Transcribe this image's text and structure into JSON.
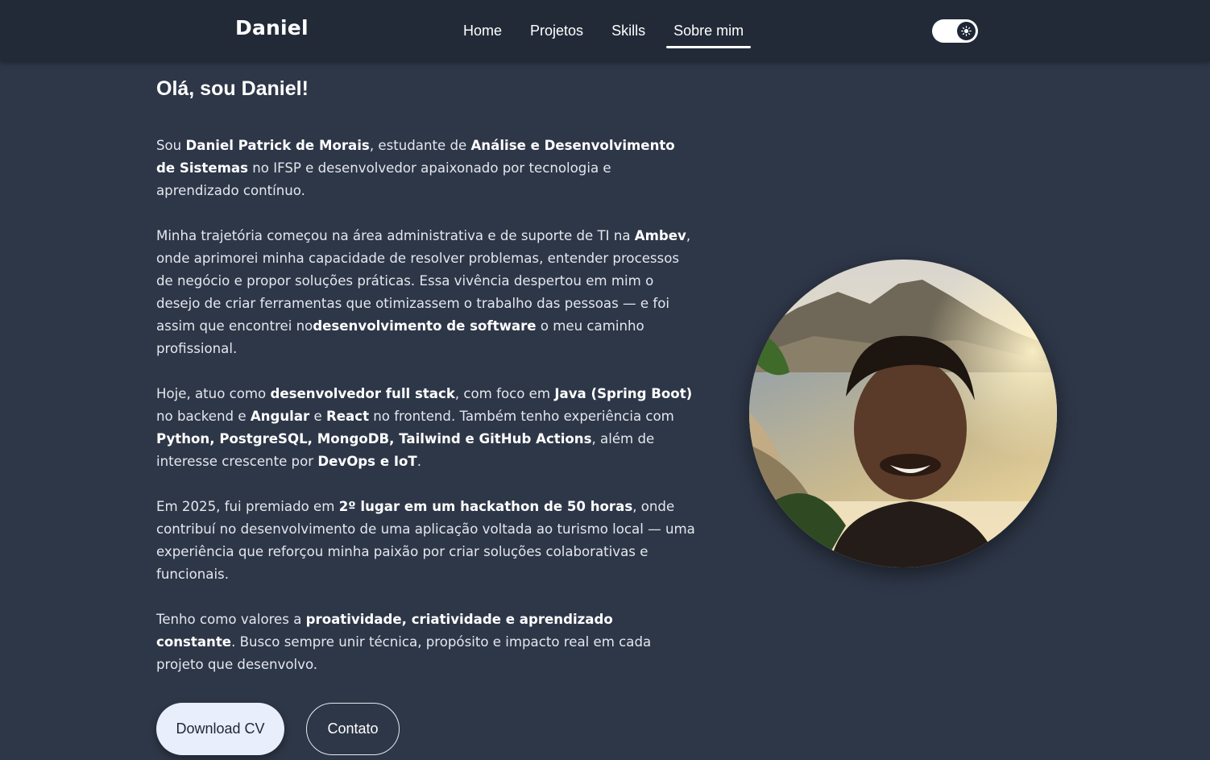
{
  "brand": "Daniel",
  "nav": [
    {
      "label": "Home",
      "active": false
    },
    {
      "label": "Projetos",
      "active": false
    },
    {
      "label": "Skills",
      "active": false
    },
    {
      "label": "Sobre mim",
      "active": true
    }
  ],
  "theme_toggle": {
    "icon": "sun-icon",
    "state": "dark"
  },
  "about": {
    "heading": "Olá, sou Daniel!",
    "paragraphs": [
      [
        {
          "t": "Sou "
        },
        {
          "t": "Daniel Patrick de Morais",
          "b": true
        },
        {
          "t": ", estudante de "
        },
        {
          "t": "Análise e Desenvolvimento de Sistemas",
          "b": true
        },
        {
          "t": " no IFSP e desenvolvedor apaixonado por tecnologia e aprendizado contínuo."
        }
      ],
      [
        {
          "t": "Minha trajetória começou na área administrativa e de suporte de TI na "
        },
        {
          "t": "Ambev",
          "b": true
        },
        {
          "t": ", onde aprimorei minha capacidade de resolver problemas, entender processos de negócio e propor soluções práticas. Essa vivência despertou em mim o desejo de criar ferramentas que otimizassem o trabalho das pessoas — e foi assim que encontrei no"
        },
        {
          "t": "desenvolvimento de software",
          "b": true
        },
        {
          "t": " o meu caminho profissional."
        }
      ],
      [
        {
          "t": "Hoje, atuo como "
        },
        {
          "t": "desenvolvedor full stack",
          "b": true
        },
        {
          "t": ", com foco em "
        },
        {
          "t": "Java (Spring Boot)",
          "b": true
        },
        {
          "t": " no backend e "
        },
        {
          "t": "Angular",
          "b": true
        },
        {
          "t": " e "
        },
        {
          "t": "React",
          "b": true
        },
        {
          "t": " no frontend. Também tenho experiência com "
        },
        {
          "t": "Python, PostgreSQL, MongoDB, Tailwind e GitHub Actions",
          "b": true
        },
        {
          "t": ", além de interesse crescente por "
        },
        {
          "t": "DevOps e IoT",
          "b": true
        },
        {
          "t": "."
        }
      ],
      [
        {
          "t": "Em 2025, fui premiado em "
        },
        {
          "t": "2º lugar em um hackathon de 50 horas",
          "b": true
        },
        {
          "t": ", onde contribuí no desenvolvimento de uma aplicação voltada ao turismo local — uma experiência que reforçou minha paixão por criar soluções colaborativas e funcionais."
        }
      ],
      [
        {
          "t": "Tenho como valores a "
        },
        {
          "t": "proatividade, criatividade e aprendizado constante",
          "b": true
        },
        {
          "t": ". Busco sempre unir técnica, propósito e impacto real em cada projeto que desenvolvo."
        }
      ]
    ]
  },
  "buttons": {
    "download_cv": "Download CV",
    "contact": "Contato"
  },
  "colors": {
    "background": "#2e3748",
    "navbar": "#222a38",
    "primary_button": "#e8eefb"
  }
}
